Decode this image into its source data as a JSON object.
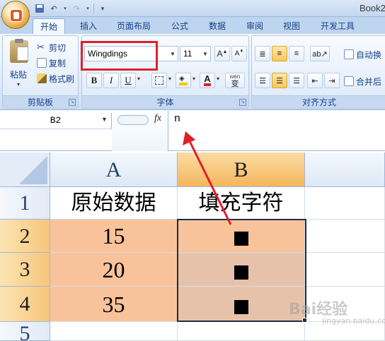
{
  "window": {
    "title": "Book2"
  },
  "ribbon": {
    "tabs": [
      "开始",
      "插入",
      "页面布局",
      "公式",
      "数据",
      "审阅",
      "视图",
      "开发工具"
    ],
    "active_tab": "开始",
    "clipboard": {
      "paste": "粘贴",
      "cut": "剪切",
      "copy": "复制",
      "format_painter": "格式刷",
      "label": "剪贴板"
    },
    "font": {
      "name": "Wingdings",
      "size": "11",
      "bold": "B",
      "italic": "I",
      "underline": "U",
      "phonetic": "wén",
      "phonetic_sub": "变",
      "label": "字体"
    },
    "alignment": {
      "wrap_text": "自动换",
      "merge_center": "合并后",
      "label": "对齐方式"
    }
  },
  "formula_bar": {
    "name_box": "B2",
    "fx": "fx",
    "content": "n"
  },
  "grid": {
    "columns": [
      "A",
      "B"
    ],
    "selected_column": "B",
    "rows": [
      {
        "num": "1",
        "a": "原始数据",
        "b": "填充字符"
      },
      {
        "num": "2",
        "a": "15",
        "b": "■"
      },
      {
        "num": "3",
        "a": "20",
        "b": "■"
      },
      {
        "num": "4",
        "a": "35",
        "b": "■"
      },
      {
        "num": "5",
        "a": "",
        "b": ""
      }
    ]
  },
  "watermark": {
    "text": "Bai经验",
    "sub": "jingyan.baidu.com"
  },
  "colors": {
    "accent_red": "#e0202a",
    "selection_peach": "#f8c39a",
    "ribbon_blue": "#15428b"
  }
}
